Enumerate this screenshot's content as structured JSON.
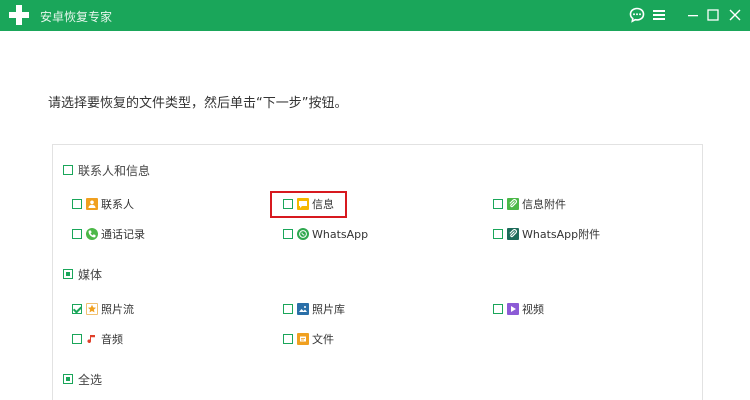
{
  "app": {
    "title": "安卓恢复专家"
  },
  "instruction": "请选择要恢复的文件类型，然后单击“下一步”按钮。",
  "groups": [
    {
      "label": "联系人和信息",
      "state": "unchecked",
      "items": [
        {
          "label": "联系人",
          "checked": false,
          "icon": "contacts-icon",
          "color": "#f0a020"
        },
        {
          "label": "信息",
          "checked": false,
          "icon": "messages-icon",
          "color": "#f5b800"
        },
        {
          "label": "信息附件",
          "checked": false,
          "icon": "message-attachment-icon",
          "color": "#4cb848"
        },
        {
          "label": "通话记录",
          "checked": false,
          "icon": "call-log-icon",
          "color": "#4cb848"
        },
        {
          "label": "WhatsApp",
          "checked": false,
          "icon": "whatsapp-icon",
          "color": "#2fa84f"
        },
        {
          "label": "WhatsApp附件",
          "checked": false,
          "icon": "whatsapp-attachment-icon",
          "color": "#1e6b5a"
        }
      ]
    },
    {
      "label": "媒体",
      "state": "partial",
      "items": [
        {
          "label": "照片流",
          "checked": true,
          "icon": "photo-stream-icon",
          "color": "#f0a020"
        },
        {
          "label": "照片库",
          "checked": false,
          "icon": "photo-library-icon",
          "color": "#2a6fa8"
        },
        {
          "label": "视频",
          "checked": false,
          "icon": "video-icon",
          "color": "#8c5bd6"
        },
        {
          "label": "音频",
          "checked": false,
          "icon": "audio-icon",
          "color": "#e0402a"
        },
        {
          "label": "文件",
          "checked": false,
          "icon": "document-icon",
          "color": "#f0a020"
        }
      ]
    },
    {
      "label": "全选",
      "state": "partial",
      "items": []
    }
  ],
  "colors": {
    "titlebar": "#1aa65a",
    "accent": "#1aa65a",
    "highlight": "#d7191f"
  }
}
